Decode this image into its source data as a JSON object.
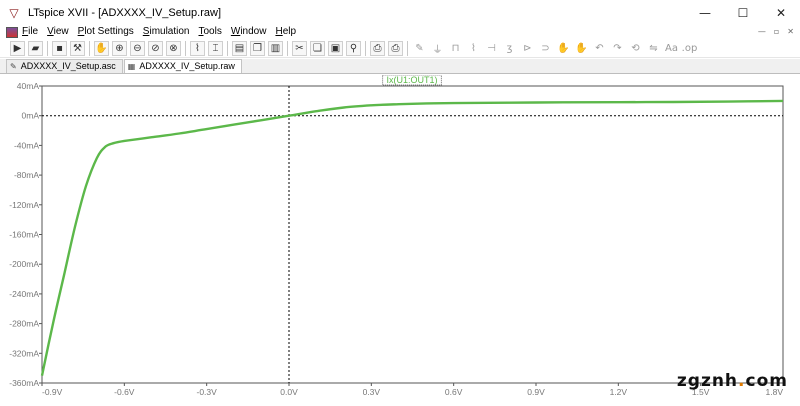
{
  "window": {
    "title": "LTspice XVII - [ADXXXX_IV_Setup.raw]",
    "app_icon": "ltspice-logo-icon",
    "controls": {
      "minimize": "—",
      "maximize": "☐",
      "close": "✕"
    }
  },
  "menu": {
    "items": [
      "File",
      "View",
      "Plot Settings",
      "Simulation",
      "Tools",
      "Window",
      "Help"
    ],
    "mdi_controls": {
      "minimize": "—",
      "restore": "▫",
      "close": "✕"
    }
  },
  "toolbar": {
    "buttons": [
      {
        "name": "run-icon",
        "glyph": "▶"
      },
      {
        "name": "open-icon",
        "glyph": "▰"
      },
      {
        "name": "save-icon",
        "glyph": "▪"
      },
      {
        "name": "control-panel-icon",
        "glyph": "⚒"
      },
      {
        "name": "pan-icon",
        "glyph": "✋"
      },
      {
        "name": "zoom-in-icon",
        "glyph": "⊕"
      },
      {
        "name": "zoom-out-icon",
        "glyph": "⊖"
      },
      {
        "name": "zoom-area-icon",
        "glyph": "⊘"
      },
      {
        "name": "zoom-fit-icon",
        "glyph": "⊗"
      },
      {
        "name": "autorange-icon",
        "glyph": "⌇"
      },
      {
        "name": "fit-icon",
        "glyph": "⌶"
      },
      {
        "name": "tile-horizontal-icon",
        "glyph": "▤"
      },
      {
        "name": "cascade-icon",
        "glyph": "❐"
      },
      {
        "name": "tile-vertical-icon",
        "glyph": "▥"
      },
      {
        "name": "cut-icon",
        "glyph": "✂"
      },
      {
        "name": "copy-icon",
        "glyph": "❏"
      },
      {
        "name": "paste-icon",
        "glyph": "▣"
      },
      {
        "name": "find-icon",
        "glyph": "⚲"
      },
      {
        "name": "print-preview-icon",
        "glyph": "⎙"
      },
      {
        "name": "print-icon",
        "glyph": "⎙"
      },
      {
        "name": "wire-icon",
        "glyph": "✎"
      },
      {
        "name": "ground-icon",
        "glyph": "⏚"
      },
      {
        "name": "label-icon",
        "glyph": "⊓"
      },
      {
        "name": "resistor-icon",
        "glyph": "⌇"
      },
      {
        "name": "capacitor-icon",
        "glyph": "⊣"
      },
      {
        "name": "inductor-icon",
        "glyph": "ʒ"
      },
      {
        "name": "diode-icon",
        "glyph": "⊳"
      },
      {
        "name": "component-icon",
        "glyph": "⊃"
      },
      {
        "name": "move-icon",
        "glyph": "✋"
      },
      {
        "name": "drag-icon",
        "glyph": "✋"
      },
      {
        "name": "undo-icon",
        "glyph": "↶"
      },
      {
        "name": "redo-icon",
        "glyph": "↷"
      },
      {
        "name": "rotate-icon",
        "glyph": "⟲"
      },
      {
        "name": "mirror-icon",
        "glyph": "⇋"
      },
      {
        "name": "text-icon",
        "glyph": "Aa"
      },
      {
        "name": "spice-directive-icon",
        "glyph": ".op"
      }
    ]
  },
  "tabs": [
    {
      "label": "ADXXXX_IV_Setup.asc",
      "icon": "schematic-icon",
      "glyph": "✎",
      "active": false
    },
    {
      "label": "ADXXXX_IV_Setup.raw",
      "icon": "waveform-icon",
      "glyph": "▦",
      "active": true
    }
  ],
  "chart_data": {
    "type": "line",
    "trace_label": "Ix(U1:OUT1)",
    "x_tick_labels": [
      "-0.9V",
      "-0.6V",
      "-0.3V",
      "0.0V",
      "0.3V",
      "0.6V",
      "0.9V",
      "1.2V",
      "1.5V",
      "1.8V"
    ],
    "y_tick_labels": [
      "40mA",
      "0mA",
      "-40mA",
      "-80mA",
      "-120mA",
      "-160mA",
      "-200mA",
      "-240mA",
      "-280mA",
      "-320mA",
      "-360mA"
    ],
    "xlim": [
      -0.9,
      1.8
    ],
    "ylim": [
      -360,
      40
    ],
    "x_unit": "V",
    "y_unit": "mA",
    "series": [
      {
        "color": "#5cb84a",
        "x": [
          -0.9,
          -0.86,
          -0.82,
          -0.78,
          -0.74,
          -0.7,
          -0.67,
          -0.64,
          -0.6,
          -0.5,
          -0.4,
          -0.3,
          -0.2,
          -0.1,
          0.0,
          0.1,
          0.2,
          0.3,
          0.4,
          0.5,
          0.6,
          0.8,
          1.0,
          1.2,
          1.4,
          1.6,
          1.8
        ],
        "y": [
          -350,
          -280,
          -215,
          -150,
          -95,
          -57,
          -42,
          -37,
          -34,
          -29,
          -24,
          -18,
          -12,
          -6,
          0,
          6,
          11,
          14,
          15.5,
          16.5,
          17,
          17.5,
          18,
          18.2,
          18.5,
          19,
          20
        ]
      }
    ],
    "zero_lines": {
      "x": 0,
      "y": 0
    },
    "grid": false
  }
}
